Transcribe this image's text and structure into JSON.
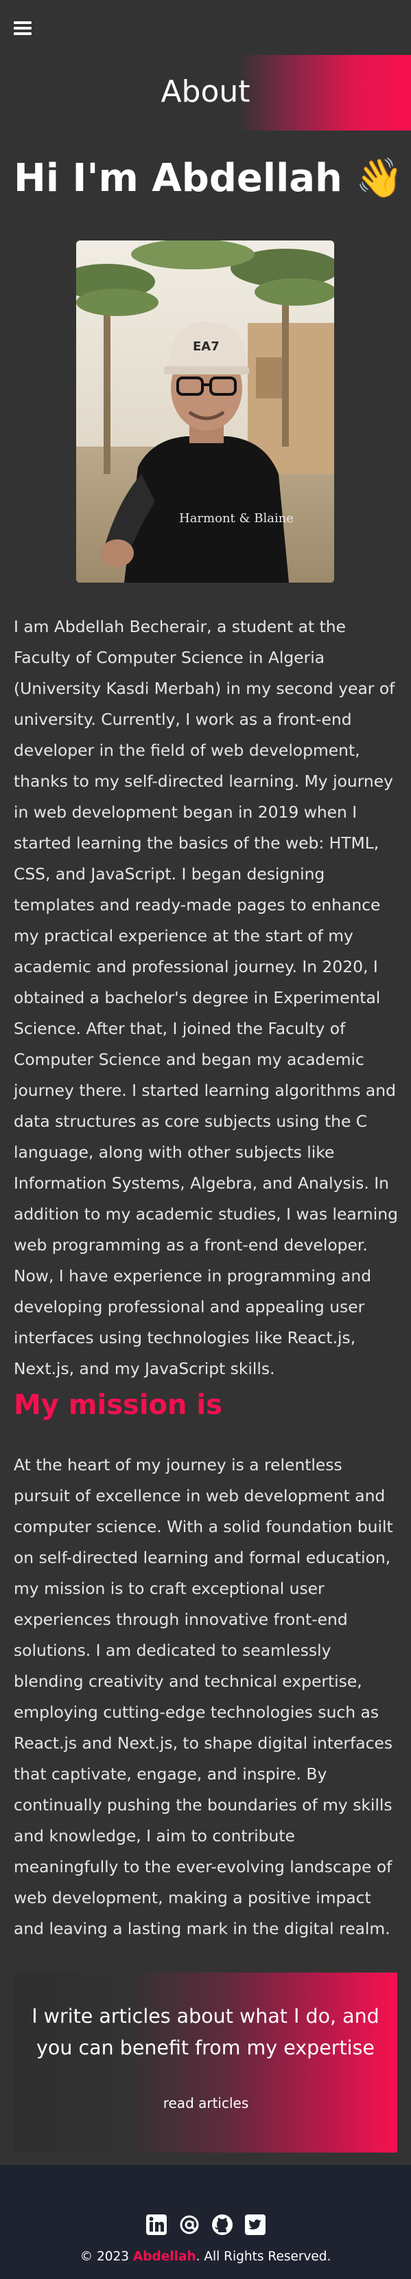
{
  "header": {
    "menu_icon": "hamburger-menu-icon"
  },
  "banner": {
    "title": "About"
  },
  "intro": {
    "heading": "Hi I'm Abdellah 👋",
    "photo_alt": "Portrait of Abdellah",
    "bio": "I am Abdellah Becherair, a student at the Faculty of Computer Science in Algeria (University Kasdi Merbah) in my second year of university. Currently, I work as a front-end developer in the field of web development, thanks to my self-directed learning. My journey in web development began in 2019 when I started learning the basics of the web: HTML, CSS, and JavaScript. I began designing templates and ready-made pages to enhance my practical experience at the start of my academic and professional journey. In 2020, I obtained a bachelor's degree in Experimental Science. After that, I joined the Faculty of Computer Science and began my academic journey there. I started learning algorithms and data structures as core subjects using the C language, along with other subjects like Information Systems, Algebra, and Analysis. In addition to my academic studies, I was learning web programming as a front-end developer. Now, I have experience in programming and developing professional and appealing user interfaces using technologies like React.js, Next.js, and my JavaScript skills."
  },
  "mission": {
    "heading": "My mission is",
    "text": "At the heart of my journey is a relentless pursuit of excellence in web development and computer science. With a solid foundation built on self-directed learning and formal education, my mission is to craft exceptional user experiences through innovative front-end solutions. I am dedicated to seamlessly blending creativity and technical expertise, employing cutting-edge technologies such as React.js and Next.js, to shape digital interfaces that captivate, engage, and inspire. By continually pushing the boundaries of my skills and knowledge, I aim to contribute meaningfully to the ever-evolving landscape of web development, making a positive impact and leaving a lasting mark in the digital realm."
  },
  "cta": {
    "text": "I write articles about what I do, and you can benefit from my expertise",
    "link_label": "read articles"
  },
  "footer": {
    "social_icons": [
      "linkedin-icon",
      "email-at-icon",
      "github-icon",
      "twitter-icon"
    ],
    "copyright_prefix": "© 2023 ",
    "copyright_name": "Abdellah",
    "copyright_suffix": ". All Rights Reserved."
  },
  "colors": {
    "background": "#333333",
    "accent": "#f2114f",
    "footer": "#1f2330",
    "text": "#ffffff"
  }
}
